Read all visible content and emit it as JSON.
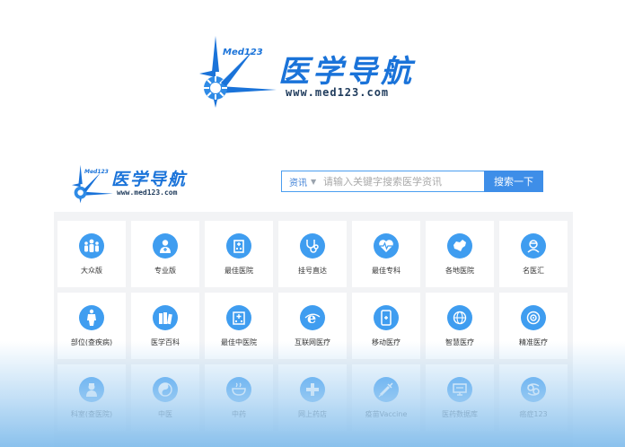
{
  "hero": {
    "brand": "医学导航",
    "url": "www.med123.com",
    "small": "Med123"
  },
  "header": {
    "brand": "医学导航",
    "url": "www.med123.com",
    "small": "Med123"
  },
  "search": {
    "category": "资讯",
    "placeholder": "请输入关键字搜索医学资讯",
    "button": "搜索一下"
  },
  "tiles": [
    {
      "label": "大众版",
      "icon": "people-group-icon"
    },
    {
      "label": "专业版",
      "icon": "doctor-icon"
    },
    {
      "label": "最佳医院",
      "icon": "hospital-building-icon"
    },
    {
      "label": "挂号直达",
      "icon": "stethoscope-icon"
    },
    {
      "label": "最佳专科",
      "icon": "heartbeat-icon"
    },
    {
      "label": "各地医院",
      "icon": "china-map-icon"
    },
    {
      "label": "名医汇",
      "icon": "doctor-head-icon"
    },
    {
      "label": "部位(查疾病)",
      "icon": "human-body-icon"
    },
    {
      "label": "医学百科",
      "icon": "books-icon"
    },
    {
      "label": "最佳中医院",
      "icon": "tcm-hospital-icon"
    },
    {
      "label": "互联网医疗",
      "icon": "internet-e-icon"
    },
    {
      "label": "移动医疗",
      "icon": "mobile-phone-icon"
    },
    {
      "label": "智慧医疗",
      "icon": "smart-globe-icon"
    },
    {
      "label": "精准医疗",
      "icon": "target-icon"
    },
    {
      "label": "科室(查医院)",
      "icon": "nurse-icon"
    },
    {
      "label": "中医",
      "icon": "yin-yang-icon"
    },
    {
      "label": "中药",
      "icon": "herbal-bowl-icon"
    },
    {
      "label": "网上药店",
      "icon": "medical-cross-icon"
    },
    {
      "label": "疫苗Vaccine",
      "icon": "syringe-icon"
    },
    {
      "label": "医药数据库",
      "icon": "database-monitor-icon"
    },
    {
      "label": "癌症123",
      "icon": "cancer-crab-icon"
    }
  ],
  "colors": {
    "accent": "#3f9df0",
    "brand": "#1a73d9",
    "panel": "#f2f3f5"
  }
}
